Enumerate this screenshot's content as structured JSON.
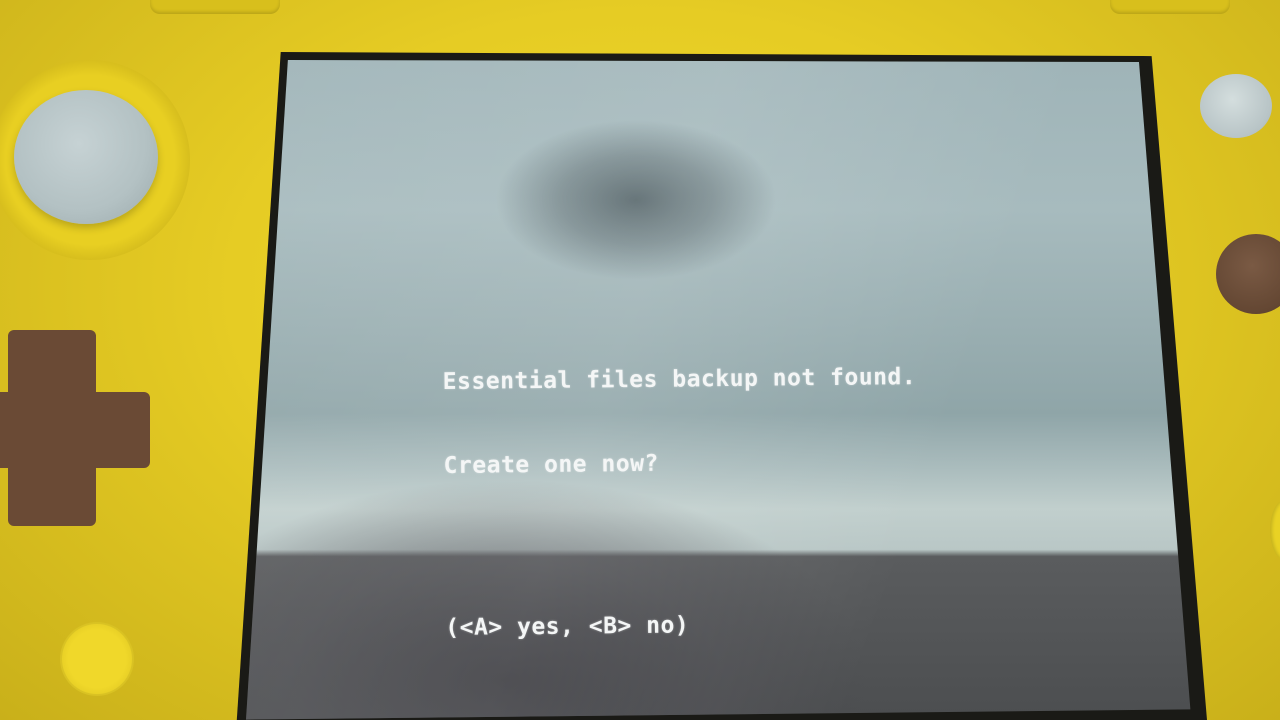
{
  "screen": {
    "message_line_1": "Essential files backup not found.",
    "message_line_2": "Create one now?",
    "prompt": "(<A> yes, <B> no)"
  },
  "colors": {
    "device_body": "#e6cc24",
    "screen_background": "#a7bbbe",
    "screen_text": "#f4f6f6",
    "dpad": "#6a4a35"
  }
}
